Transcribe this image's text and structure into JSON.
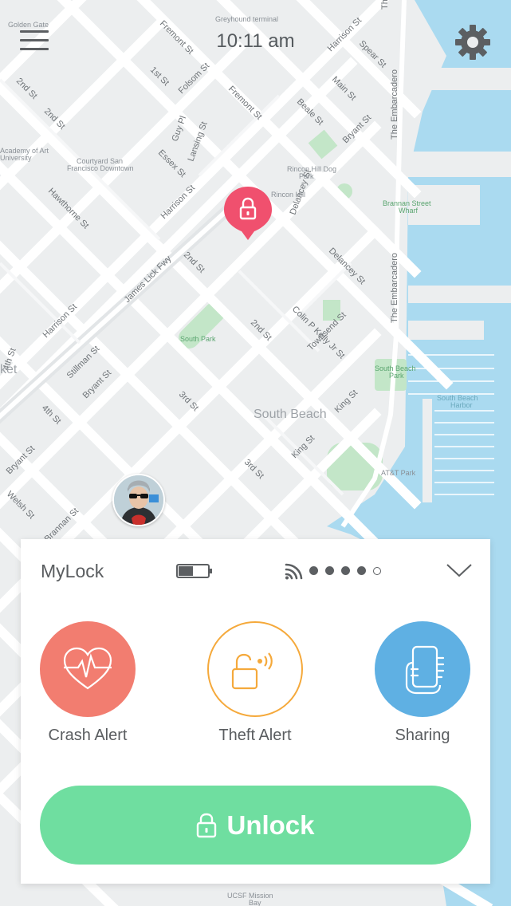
{
  "header": {
    "time": "10:11 am",
    "menu_icon": "hamburger-menu-icon",
    "settings_icon": "gear-icon"
  },
  "map": {
    "district": "South Beach",
    "streets": [
      "Fremont St",
      "Folsom St",
      "1st St",
      "2nd St",
      "Harrison St",
      "Essex St",
      "Guy Pl",
      "Lansing St",
      "Beale St",
      "Main St",
      "Spear St",
      "Bryant St",
      "Delancey St",
      "James Lick Fwy",
      "Hawthorne St",
      "Stillman St",
      "3rd St",
      "4th St",
      "King St",
      "Townsend St",
      "Colin P Kelly Jr St",
      "Welsh St",
      "Brannan St",
      "The Embarcadero"
    ],
    "places": [
      "Greyhound terminal",
      "Golden Gate University",
      "Academy of Art University",
      "Courtyard San Francisco Downtown",
      "Rincon Hill Dog Park",
      "Rincon Hill",
      "South Park",
      "South Beach Park",
      "South Beach Harbor",
      "Brannan Street Wharf",
      "AT&T Park",
      "UCSF Mission Bay"
    ],
    "colors": {
      "water": "#aadaf0",
      "park": "#c3e6c8",
      "road": "#ffffff",
      "land": "#eceeef"
    }
  },
  "lock_pin": {
    "color": "#f0506e",
    "icon": "lock-icon"
  },
  "panel": {
    "device_name": "MyLock",
    "battery_level": 0.5,
    "signal_strength": 4,
    "signal_max": 5,
    "features": [
      {
        "label": "Crash Alert",
        "icon": "heart-pulse-icon",
        "color": "#f27d70"
      },
      {
        "label": "Theft Alert",
        "icon": "lock-alarm-icon",
        "color": "#f5a93b"
      },
      {
        "label": "Sharing",
        "icon": "phone-hand-icon",
        "color": "#5fb0e3"
      }
    ],
    "unlock_label": "Unlock",
    "unlock_color": "#6fdea0"
  }
}
